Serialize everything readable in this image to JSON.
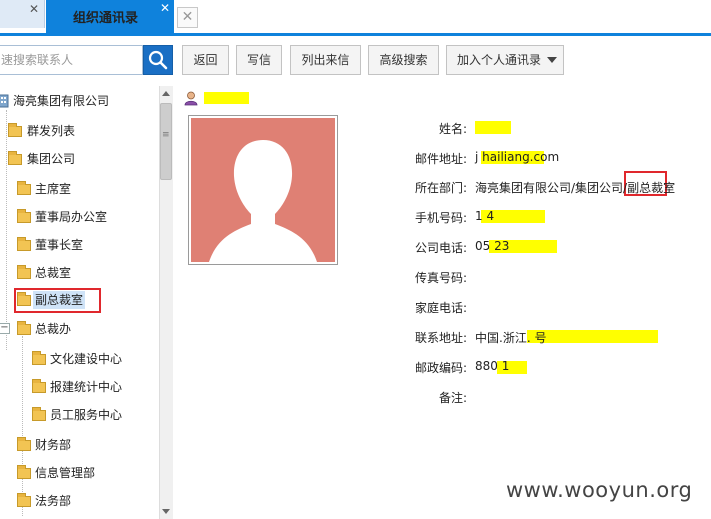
{
  "tabs": {
    "inactive_close": "✕",
    "active_label": "组织通讯录",
    "active_close": "✕",
    "new_tab": "✕"
  },
  "search": {
    "placeholder": "速搜索联系人"
  },
  "toolbar": {
    "back": "返回",
    "write": "写信",
    "list_mail": "列出来信",
    "advanced_search": "高级搜索",
    "add_personal": "加入个人通讯录"
  },
  "tree": {
    "root": "海亮集团有限公司",
    "items": [
      "群发列表",
      "集团公司",
      "主席室",
      "董事局办公室",
      "董事长室",
      "总裁室",
      "副总裁室",
      "总裁办",
      "文化建设中心",
      "报建统计中心",
      "员工服务中心",
      "财务部",
      "信息管理部",
      "法务部"
    ],
    "collapse_symbol": "⊟"
  },
  "detail": {
    "name": "",
    "fields": [
      {
        "label": "姓名:",
        "value": ""
      },
      {
        "label": "邮件地址:",
        "value": "j               hailiang.com"
      },
      {
        "label": "所在部门:",
        "value": "海亮集团有限公司/集团公司/副总裁室"
      },
      {
        "label": "手机号码:",
        "value": "1                      4"
      },
      {
        "label": "公司电话:",
        "value": "05                    23"
      },
      {
        "label": "传真号码:",
        "value": ""
      },
      {
        "label": "家庭电话:",
        "value": ""
      },
      {
        "label": "联系地址:",
        "value": "中国.浙江.                                  号"
      },
      {
        "label": "邮政编码:",
        "value": "880          1"
      },
      {
        "label": "备注:",
        "value": ""
      }
    ]
  },
  "watermark": "www.wooyun.org",
  "colors": {
    "accent": "#0f82dc",
    "highlight": "#ffff00",
    "mark": "#e0282d",
    "avatar_bg": "#df8074"
  }
}
